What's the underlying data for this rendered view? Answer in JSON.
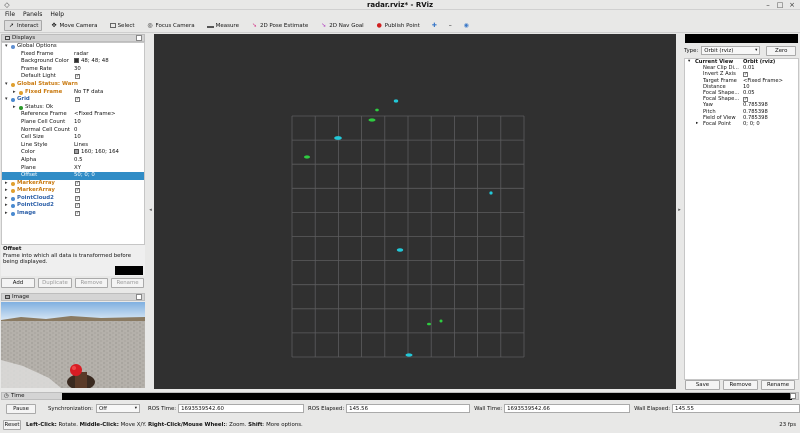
{
  "window": {
    "title": "radar.rviz* - RViz"
  },
  "menu": [
    "File",
    "Panels",
    "Help"
  ],
  "toolbar": {
    "tools": [
      {
        "label": "Interact",
        "icon": "cursor-icon",
        "active": true
      },
      {
        "label": "Move Camera",
        "icon": "move-camera-icon"
      },
      {
        "label": "Select",
        "icon": "select-icon"
      },
      {
        "label": "Focus Camera",
        "icon": "focus-camera-icon"
      },
      {
        "label": "Measure",
        "icon": "ruler-icon"
      },
      {
        "label": "2D Pose Estimate",
        "icon": "arrow-pink-icon"
      },
      {
        "label": "2D Nav Goal",
        "icon": "arrow-purple-icon"
      },
      {
        "label": "Publish Point",
        "icon": "pin-icon"
      }
    ]
  },
  "displays": {
    "header": "Displays",
    "rows": [
      {
        "indent": 0,
        "arrow": "▾",
        "icon": "gear-icon",
        "iconColor": "#5f8fd0",
        "key": "Global Options",
        "value": "",
        "style": ""
      },
      {
        "indent": 1,
        "key": "Fixed Frame",
        "value": "radar"
      },
      {
        "indent": 1,
        "key": "Background Color",
        "value": "48; 48; 48",
        "swatch": "#303030"
      },
      {
        "indent": 1,
        "key": "Frame Rate",
        "value": "30"
      },
      {
        "indent": 1,
        "key": "Default Light",
        "value": "",
        "check": true
      },
      {
        "indent": 0,
        "arrow": "▾",
        "icon": "warning-icon",
        "iconColor": "#e0a030",
        "key": "Global Status: Warn",
        "value": "",
        "style": "orange"
      },
      {
        "indent": 1,
        "arrow": "▸",
        "icon": "warning-icon",
        "iconColor": "#e0a030",
        "key": "Fixed Frame",
        "value": "No TF data",
        "style": "orange"
      },
      {
        "indent": 0,
        "arrow": "▾",
        "icon": "grid-icon",
        "iconColor": "#4a8ad0",
        "key": "Grid",
        "value": "",
        "style": "blue",
        "check": true
      },
      {
        "indent": 1,
        "arrow": "▸",
        "icon": "check-icon",
        "iconColor": "#2a9a2a",
        "key": "Status: Ok",
        "value": ""
      },
      {
        "indent": 1,
        "key": "Reference Frame",
        "value": "<Fixed Frame>"
      },
      {
        "indent": 1,
        "key": "Plane Cell Count",
        "value": "10"
      },
      {
        "indent": 1,
        "key": "Normal Cell Count",
        "value": "0"
      },
      {
        "indent": 1,
        "key": "Cell Size",
        "value": "10"
      },
      {
        "indent": 1,
        "key": "Line Style",
        "value": "Lines"
      },
      {
        "indent": 1,
        "key": "Color",
        "value": "160; 160; 164",
        "swatch": "#a0a0a4"
      },
      {
        "indent": 1,
        "key": "Alpha",
        "value": "0.5"
      },
      {
        "indent": 1,
        "key": "Plane",
        "value": "XY"
      },
      {
        "indent": 1,
        "key": "Offset",
        "value": "50; 0; 0",
        "selected": true
      },
      {
        "indent": 0,
        "arrow": "▸",
        "icon": "warning-icon",
        "iconColor": "#e0a030",
        "key": "MarkerArray",
        "value": "",
        "style": "orange",
        "check": true
      },
      {
        "indent": 0,
        "arrow": "▸",
        "icon": "warning-icon",
        "iconColor": "#e0a030",
        "key": "MarkerArray",
        "value": "",
        "style": "orange",
        "check": true
      },
      {
        "indent": 0,
        "arrow": "▸",
        "icon": "pointcloud-icon",
        "iconColor": "#4a8ad0",
        "key": "PointCloud2",
        "value": "",
        "style": "blue",
        "check": true
      },
      {
        "indent": 0,
        "arrow": "▸",
        "icon": "pointcloud-icon",
        "iconColor": "#4a8ad0",
        "key": "PointCloud2",
        "value": "",
        "style": "blue",
        "check": true
      },
      {
        "indent": 0,
        "arrow": "▸",
        "icon": "image-icon",
        "iconColor": "#4a8ad0",
        "key": "Image",
        "value": "",
        "style": "blue",
        "check": true
      }
    ],
    "description": {
      "title": "Offset",
      "text": "Frame into which all data is transformed before being displayed."
    },
    "buttons": {
      "add": "Add",
      "duplicate": "Duplicate",
      "remove": "Remove",
      "rename": "Rename"
    }
  },
  "image_panel": {
    "header": "Image"
  },
  "views": {
    "type_label": "Type:",
    "type_value": "Orbit (rviz)",
    "zero": "Zero",
    "rows": [
      {
        "indent": 0,
        "arrow": "▾",
        "key": "Current View",
        "value": "Orbit (rviz)",
        "bold": true
      },
      {
        "indent": 1,
        "key": "Near Clip Di...",
        "value": "0.01"
      },
      {
        "indent": 1,
        "key": "Invert Z Axis",
        "value": "",
        "check": true
      },
      {
        "indent": 1,
        "key": "Target Frame",
        "value": "<Fixed Frame>"
      },
      {
        "indent": 1,
        "key": "Distance",
        "value": "10"
      },
      {
        "indent": 1,
        "key": "Focal Shape...",
        "value": "0.05"
      },
      {
        "indent": 1,
        "key": "Focal Shape...",
        "value": "",
        "check": true
      },
      {
        "indent": 1,
        "key": "Yaw",
        "value": "0.785398"
      },
      {
        "indent": 1,
        "key": "Pitch",
        "value": "0.785398"
      },
      {
        "indent": 1,
        "key": "Field of View",
        "value": "0.785398"
      },
      {
        "indent": 1,
        "arrow": "▸",
        "key": "Focal Point",
        "value": "0; 0; 0"
      }
    ],
    "buttons": {
      "save": "Save",
      "remove": "Remove",
      "rename": "Rename"
    }
  },
  "time": {
    "header": "Time",
    "pause": "Pause",
    "sync_label": "Synchronization:",
    "sync_value": "Off",
    "ros_time_label": "ROS Time:",
    "ros_time": "1693539542.60",
    "ros_elapsed_label": "ROS Elapsed:",
    "ros_elapsed": "145.56",
    "wall_time_label": "Wall Time:",
    "wall_time": "1693539542.66",
    "wall_elapsed_label": "Wall Elapsed:",
    "wall_elapsed": "145.55"
  },
  "status": {
    "reset": "Reset",
    "hint_b1": "Left-Click:",
    "hint_t1": " Rotate. ",
    "hint_b2": "Middle-Click:",
    "hint_t2": " Move X/Y. ",
    "hint_b3": "Right-Click/Mouse Wheel:",
    "hint_t3": ": Zoom. ",
    "hint_b4": "Shift",
    "hint_t4": ": More options.",
    "fps": "23 fps"
  }
}
